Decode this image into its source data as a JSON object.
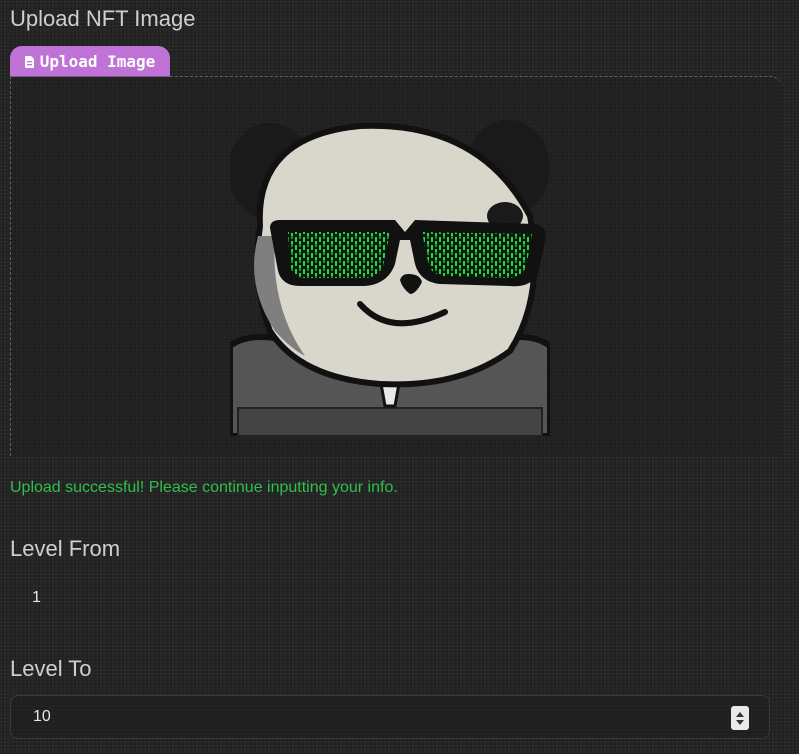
{
  "upload_section": {
    "title": "Upload NFT Image",
    "tab_label": "Upload Image",
    "tab_icon": "file-icon",
    "tab_color": "#c073d6",
    "image_subject": "panda-avatar",
    "success_message": "Upload successful! Please continue inputting your info.",
    "success_color": "#2fbf4c"
  },
  "level_from": {
    "label": "Level From",
    "value": "1"
  },
  "level_to": {
    "label": "Level To",
    "value": "10"
  }
}
